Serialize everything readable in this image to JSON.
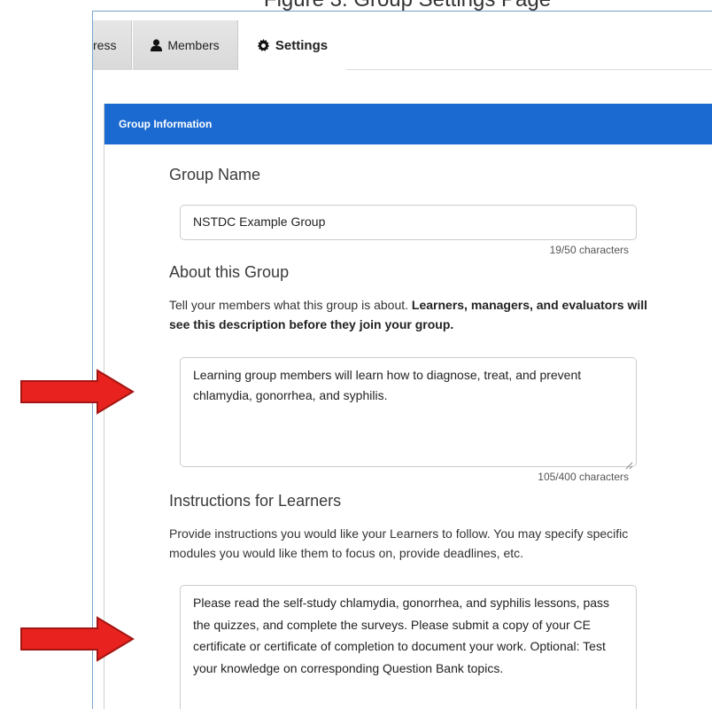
{
  "caption": "Figure 3. Group Settings Page",
  "tabs": [
    {
      "label": "ress",
      "icon": "none"
    },
    {
      "label": "Members",
      "icon": "user-icon"
    },
    {
      "label": "Settings",
      "icon": "gear-icon"
    }
  ],
  "panel": {
    "title": "Group Information",
    "color": "#1b6ad1"
  },
  "group_name": {
    "label": "Group Name",
    "value": "NSTDC Example Group",
    "counter": "19/50 characters"
  },
  "about": {
    "label": "About this Group",
    "help_plain": "Tell your members what this group is about. ",
    "help_bold": "Learners, managers, and evaluators will see this description before they join your group.",
    "value": "Learning group members will learn how to diagnose, treat, and prevent chlamydia, gonorrhea, and syphilis.",
    "counter": "105/400 characters"
  },
  "instructions": {
    "label": "Instructions for Learners",
    "help": "Provide instructions you would like your Learners to follow. You may specify specific modules you would like them to focus on, provide deadlines, etc.",
    "value": "Please read the self-study chlamydia, gonorrhea, and syphilis lessons, pass the quizzes, and complete the surveys. Please submit a copy of your CE certificate or certificate of completion to document your work. Optional: Test your knowledge on corresponding Question Bank topics."
  },
  "annotation_color": "#e8231f"
}
